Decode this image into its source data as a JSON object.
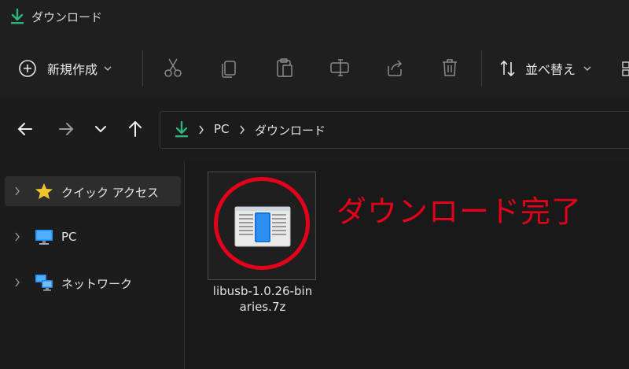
{
  "window": {
    "title": "ダウンロード"
  },
  "toolbar": {
    "new_label": "新規作成",
    "sort_label": "並べ替え"
  },
  "address": {
    "crumbs": [
      "PC",
      "ダウンロード"
    ]
  },
  "sidebar": {
    "items": [
      {
        "label": "クイック アクセス",
        "icon": "star-icon",
        "selected": true
      },
      {
        "label": "PC",
        "icon": "pc-icon"
      },
      {
        "label": "ネットワーク",
        "icon": "network-icon"
      }
    ]
  },
  "files": [
    {
      "name_line1": "libusb-1.0.26-bin",
      "name_line2": "aries.7z",
      "icon": "archive-file-icon"
    }
  ],
  "annotation": {
    "text": "ダウンロード完了",
    "color": "#e3001b"
  },
  "colors": {
    "accent_download": "#2fb37a",
    "star": "#f4c430",
    "pc_blue": "#1e90ff"
  }
}
